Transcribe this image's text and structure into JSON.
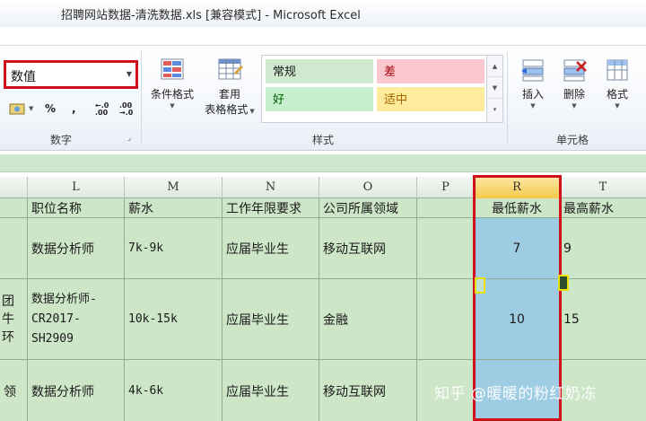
{
  "window": {
    "title": "招聘网站数据-清洗数据.xls  [兼容模式]  -  Microsoft Excel"
  },
  "ribbon": {
    "number_group": {
      "label": "数字",
      "format_value": "数值",
      "percent": "%",
      "comma": ",",
      "inc_decimal": "←.0\n.00",
      "dec_decimal": ".00\n→.0"
    },
    "styles_group": {
      "label": "样式",
      "conditional_format": "条件格式",
      "table_format_line1": "套用",
      "table_format_line2": "表格格式",
      "cells": [
        {
          "text": "常规",
          "bg": "#cfe9cf",
          "color": "#1a1a1a"
        },
        {
          "text": "差",
          "bg": "#fbc7ce",
          "color": "#9c0006"
        },
        {
          "text": "好",
          "bg": "#c6efce",
          "color": "#006100"
        },
        {
          "text": "适中",
          "bg": "#ffeb9c",
          "color": "#9c6500"
        }
      ]
    },
    "cells_group": {
      "label": "单元格",
      "insert": "插入",
      "delete": "删除",
      "format": "格式"
    }
  },
  "grid": {
    "columns": [
      "L",
      "M",
      "N",
      "O",
      "P",
      "R",
      "T"
    ],
    "header_row": [
      "职位名称",
      "薪水",
      "工作年限要求",
      "公司所属领域",
      "",
      "最低薪水",
      "最高薪水"
    ],
    "rows": [
      {
        "left_fragment": "",
        "cells": [
          "数据分析师",
          "7k-9k",
          "应届毕业生",
          "移动互联网",
          "",
          "7",
          "9"
        ]
      },
      {
        "left_fragment": "团\n牛\n环",
        "cells": [
          "数据分析师-\nCR2017-\nSH2909",
          "10k-15k",
          "应届毕业生",
          "金融",
          "",
          "10",
          "15"
        ]
      },
      {
        "left_fragment": "领",
        "cells": [
          "数据分析师",
          "4k-6k",
          "应届毕业生",
          "移动互联网",
          "",
          "",
          ""
        ]
      }
    ]
  },
  "watermark": "知乎 @暖暖的粉红奶冻",
  "colors": {
    "highlight_red": "#d0101a",
    "selected_column": "#9ecde3",
    "sheet_green": "#cde6c8",
    "marker_yellow": "#e8e000"
  }
}
